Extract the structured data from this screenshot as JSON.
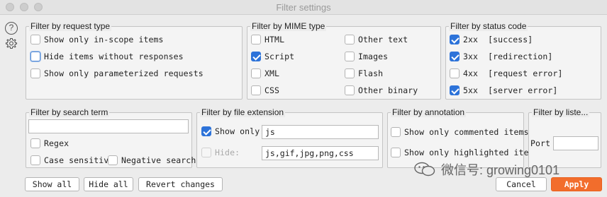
{
  "window": {
    "title": "Filter settings"
  },
  "request_type": {
    "title": "Filter by request type",
    "options": [
      {
        "label": "Show only in-scope items",
        "checked": false
      },
      {
        "label": "Hide items without responses",
        "checked": false,
        "focused": true
      },
      {
        "label": "Show only parameterized requests",
        "checked": false
      }
    ]
  },
  "mime_type": {
    "title": "Filter by MIME type",
    "options": [
      {
        "label": "HTML",
        "checked": false
      },
      {
        "label": "Other text",
        "checked": false
      },
      {
        "label": "Script",
        "checked": true
      },
      {
        "label": "Images",
        "checked": false
      },
      {
        "label": "XML",
        "checked": false
      },
      {
        "label": "Flash",
        "checked": false
      },
      {
        "label": "CSS",
        "checked": false
      },
      {
        "label": "Other binary",
        "checked": false
      }
    ]
  },
  "status_code": {
    "title": "Filter by status code",
    "options": [
      {
        "label": "2xx  [success]",
        "checked": true
      },
      {
        "label": "3xx  [redirection]",
        "checked": true
      },
      {
        "label": "4xx  [request error]",
        "checked": false
      },
      {
        "label": "5xx  [server error]",
        "checked": true
      }
    ]
  },
  "search_term": {
    "title": "Filter by search term",
    "value": "",
    "regex": {
      "label": "Regex",
      "checked": false
    },
    "case_sensitive": {
      "label": "Case sensitive",
      "checked": false
    },
    "negative_search": {
      "label": "Negative search",
      "checked": false
    }
  },
  "file_extension": {
    "title": "Filter by file extension",
    "show_only": {
      "label": "Show only:",
      "checked": true,
      "value": "js"
    },
    "hide": {
      "label": "Hide:",
      "checked": false,
      "disabled": true,
      "value": "js,gif,jpg,png,css"
    }
  },
  "annotation": {
    "title": "Filter by annotation",
    "options": [
      {
        "label": "Show only commented items",
        "checked": false
      },
      {
        "label": "Show only highlighted items",
        "checked": false
      }
    ]
  },
  "listener": {
    "title": "Filter by liste...",
    "port_label": "Port",
    "port_value": ""
  },
  "buttons": {
    "show_all": "Show all",
    "hide_all": "Hide all",
    "revert": "Revert changes",
    "cancel": "Cancel",
    "apply": "Apply"
  },
  "watermark": "微信号: growing0101",
  "icons": {
    "help": "question-circle-icon",
    "settings": "gear-icon",
    "watermark": "wechat-icon"
  },
  "colors": {
    "accent": "#2d73d9",
    "apply": "#f26d2c"
  }
}
